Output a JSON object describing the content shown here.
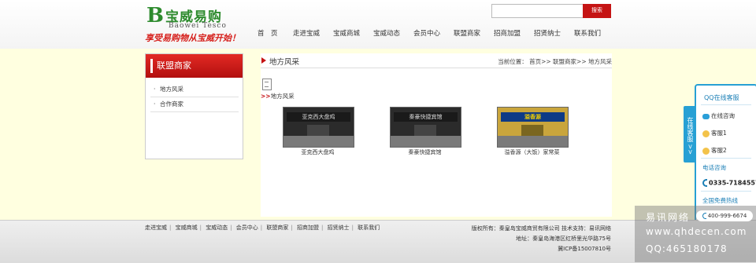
{
  "logo": {
    "letter": "B",
    "name": "宝威易购",
    "subtitle": "Baowei Tesco",
    "slogan": "享受易购物从宝威开始！"
  },
  "search": {
    "value": "",
    "placeholder": "",
    "button_label": "搜索"
  },
  "nav": {
    "items": [
      "首　页",
      "走进宝威",
      "宝威商城",
      "宝威动态",
      "会员中心",
      "联盟商家",
      "招商加盟",
      "招贤纳士",
      "联系我们"
    ]
  },
  "sidebar": {
    "title": "联盟商家",
    "items": [
      "地方风采",
      "合作商家"
    ]
  },
  "main": {
    "title": "地方风采",
    "breadcrumb": "当前位置： 首页>> 联盟商家>> 地方风采",
    "section_label": "地方风采",
    "section_arrow": ">>",
    "photos": [
      {
        "sign": "亚克西大盘鸡",
        "caption": "亚克西大盘鸡"
      },
      {
        "sign": "秦豪快捷宾馆",
        "caption": "秦豪快捷宾馆"
      },
      {
        "sign": "溢香源",
        "caption": "溢香源（大饭）家常菜"
      }
    ]
  },
  "float_panel": {
    "tab_label": "在线客服 >>",
    "title": "QQ在线客服",
    "consult": "在线咨询",
    "service1": "客服1",
    "service2": "客服2",
    "phone_label": "电话咨询",
    "phone": "0335-7184557",
    "hotline_label": "全国免费热线",
    "hotline": "400-999-6674"
  },
  "footer": {
    "links": [
      "走进宝威",
      "宝威商城",
      "宝威动态",
      "会员中心",
      "联盟商家",
      "招商加盟",
      "招贤纳士",
      "联系我们"
    ],
    "copyright": "版权所有：秦皇岛宝威商贸有限公司 技术支持：易讯网络",
    "address": "地址：秦皇岛海港区红桥里光华路75号",
    "icp": "冀ICP备15007810号"
  },
  "watermark": {
    "line1": "易讯网络",
    "line2": "www.qhdecen.com",
    "line3": "QQ:465180178"
  },
  "colors": {
    "accent_red": "#c51414",
    "band_yellow": "#ffffe0",
    "service_blue": "#27a0d4"
  }
}
